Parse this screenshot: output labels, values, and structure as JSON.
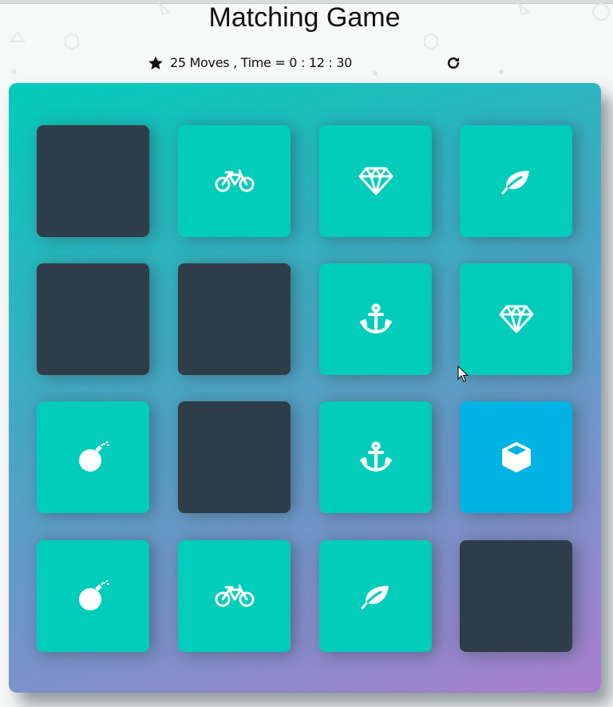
{
  "title": "Matching Game",
  "score_panel": {
    "stars_icon": "star-icon",
    "moves_text": "25 Moves , Time = 0 : 12 : 30",
    "restart_icon": "restart-icon"
  },
  "deck": {
    "gradient_colors": [
      "#02ccba",
      "#aa7ecd"
    ],
    "card_colors": {
      "closed": "#2e3d49",
      "match": "#02ccba",
      "open": "#02b3e4"
    },
    "cards": [
      {
        "state": "closed",
        "icon": ""
      },
      {
        "state": "match",
        "icon": "bicycle-icon"
      },
      {
        "state": "match",
        "icon": "diamond-icon"
      },
      {
        "state": "match",
        "icon": "leaf-icon"
      },
      {
        "state": "closed",
        "icon": ""
      },
      {
        "state": "closed",
        "icon": ""
      },
      {
        "state": "match",
        "icon": "anchor-icon"
      },
      {
        "state": "match",
        "icon": "diamond-icon"
      },
      {
        "state": "match",
        "icon": "bomb-icon"
      },
      {
        "state": "closed",
        "icon": ""
      },
      {
        "state": "match",
        "icon": "anchor-icon"
      },
      {
        "state": "open",
        "icon": "cube-icon"
      },
      {
        "state": "match",
        "icon": "bomb-icon"
      },
      {
        "state": "match",
        "icon": "bicycle-icon"
      },
      {
        "state": "match",
        "icon": "leaf-icon"
      },
      {
        "state": "closed",
        "icon": ""
      }
    ]
  }
}
